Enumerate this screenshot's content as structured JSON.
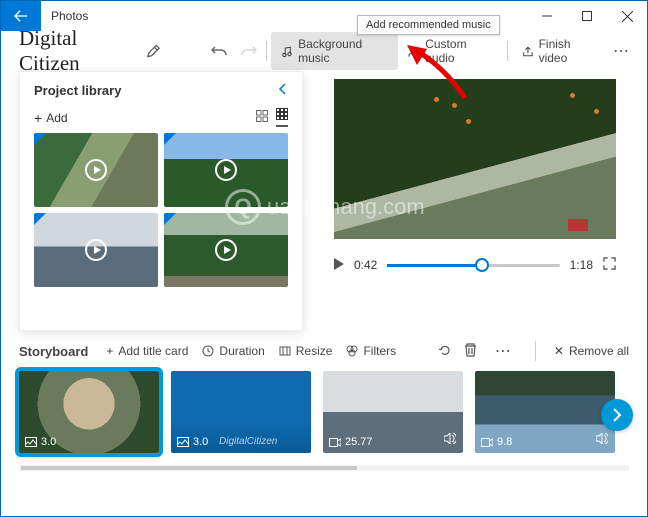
{
  "window": {
    "app_title": "Photos",
    "tooltip": "Add recommended music"
  },
  "project": {
    "name": "Digital Citizen"
  },
  "toolbar": {
    "bgmusic": "Background music",
    "custom": "Custom audio",
    "finish": "Finish video"
  },
  "library": {
    "title": "Project library",
    "add": "Add"
  },
  "player": {
    "current": "0:42",
    "total": "1:18"
  },
  "storyboard": {
    "title": "Storyboard",
    "add_title": "Add title card",
    "duration": "Duration",
    "resize": "Resize",
    "filters": "Filters",
    "remove": "Remove all",
    "clips": [
      "3.0",
      "3.0",
      "25.77",
      "9.8"
    ],
    "clip2_label": "DigitalCitizen"
  },
  "watermark": "uantrimang.com"
}
